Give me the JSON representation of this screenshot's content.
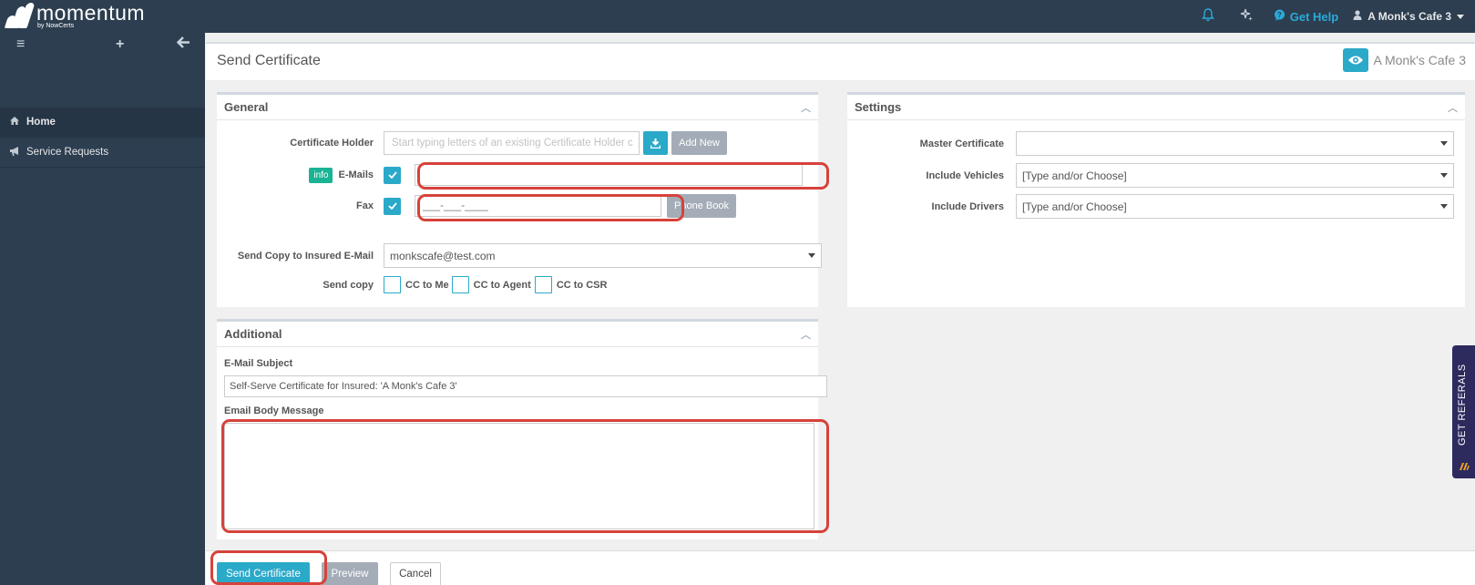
{
  "brand": {
    "name": "momentum",
    "sub": "by NowCerts"
  },
  "topbar": {
    "help_label": "Get Help",
    "user_label": "A Monk's Cafe 3"
  },
  "sidebar": {
    "items": [
      {
        "label": "Home"
      },
      {
        "label": "Service Requests"
      }
    ]
  },
  "page": {
    "title": "Send Certificate",
    "client": "A Monk's Cafe 3"
  },
  "general": {
    "title": "General",
    "certificate_holder_label": "Certificate Holder",
    "certificate_holder_placeholder": "Start typing letters of an existing Certificate Holder c",
    "add_new_label": "Add New",
    "info_badge": "info",
    "emails_label": "E-Mails",
    "emails_value": "",
    "fax_label": "Fax",
    "fax_value": "___-___-____",
    "phone_book_label": "Phone Book",
    "send_copy_insured_label": "Send Copy to Insured E-Mail",
    "send_copy_insured_value": "monkscafe@test.com",
    "send_copy_label": "Send copy",
    "cc_options": [
      "CC to Me",
      "CC to Agent",
      "CC to CSR"
    ]
  },
  "settings": {
    "title": "Settings",
    "master_certificate_label": "Master Certificate",
    "master_certificate_value": "",
    "include_vehicles_label": "Include Vehicles",
    "include_vehicles_value": "[Type and/or Choose]",
    "include_drivers_label": "Include Drivers",
    "include_drivers_value": "[Type and/or Choose]"
  },
  "additional": {
    "title": "Additional",
    "subject_label": "E-Mail Subject",
    "subject_value": "Self-Serve Certificate for Insured: 'A Monk's Cafe 3'",
    "body_label": "Email Body Message",
    "body_value": ""
  },
  "footer": {
    "send_label": "Send Certificate",
    "preview_label": "Preview",
    "cancel_label": "Cancel"
  },
  "referral_tab": {
    "label": "GET REFERALS"
  },
  "colors": {
    "sidebar": "#2c3e50",
    "accent": "#2ba9c9",
    "highlight": "#d6423a",
    "info_badge": "#1ab394"
  }
}
